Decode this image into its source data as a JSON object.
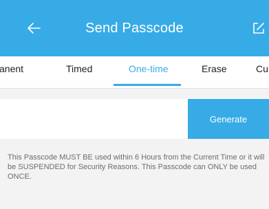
{
  "header": {
    "title": "Send Passcode",
    "back_icon": "arrow-left-icon",
    "edit_icon": "edit-icon"
  },
  "tabs": [
    {
      "label": "anent"
    },
    {
      "label": "Timed"
    },
    {
      "label": "One-time",
      "active": true
    },
    {
      "label": "Erase"
    },
    {
      "label": "Cu"
    }
  ],
  "input": {
    "value": "",
    "placeholder": "",
    "button_label": "Generate"
  },
  "note": "This Passcode MUST BE used within 6 Hours from the Current Time or it will be SUSPENDED for Security Reasons. This Passcode can ONLY be used ONCE.",
  "colors": {
    "accent": "#37abe6",
    "background": "#f3f3f3"
  }
}
